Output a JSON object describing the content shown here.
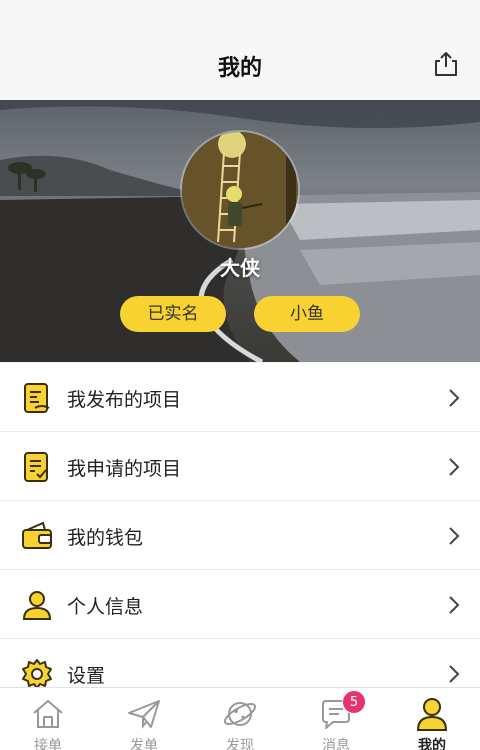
{
  "header": {
    "title": "我的",
    "share_icon": "share-icon"
  },
  "profile": {
    "nickname": "大侠",
    "verified_tag": "已实名",
    "level_tag": "小鱼"
  },
  "menu": {
    "items": [
      {
        "label": "我发布的项目",
        "icon": "published-document-icon"
      },
      {
        "label": "我申请的项目",
        "icon": "applied-document-icon"
      },
      {
        "label": "我的钱包",
        "icon": "wallet-icon"
      },
      {
        "label": "个人信息",
        "icon": "user-icon"
      },
      {
        "label": "设置",
        "icon": "gear-icon"
      }
    ]
  },
  "tabbar": {
    "tabs": [
      {
        "label": "接单",
        "icon": "home-icon"
      },
      {
        "label": "发单",
        "icon": "paper-plane-icon"
      },
      {
        "label": "发现",
        "icon": "planet-icon"
      },
      {
        "label": "消息",
        "icon": "message-icon",
        "badge": "5"
      },
      {
        "label": "我的",
        "icon": "profile-icon",
        "active": true
      }
    ]
  },
  "colors": {
    "accent": "#f8d231",
    "badge": "#e8336d",
    "icon_outline": "#3a2f0a"
  }
}
